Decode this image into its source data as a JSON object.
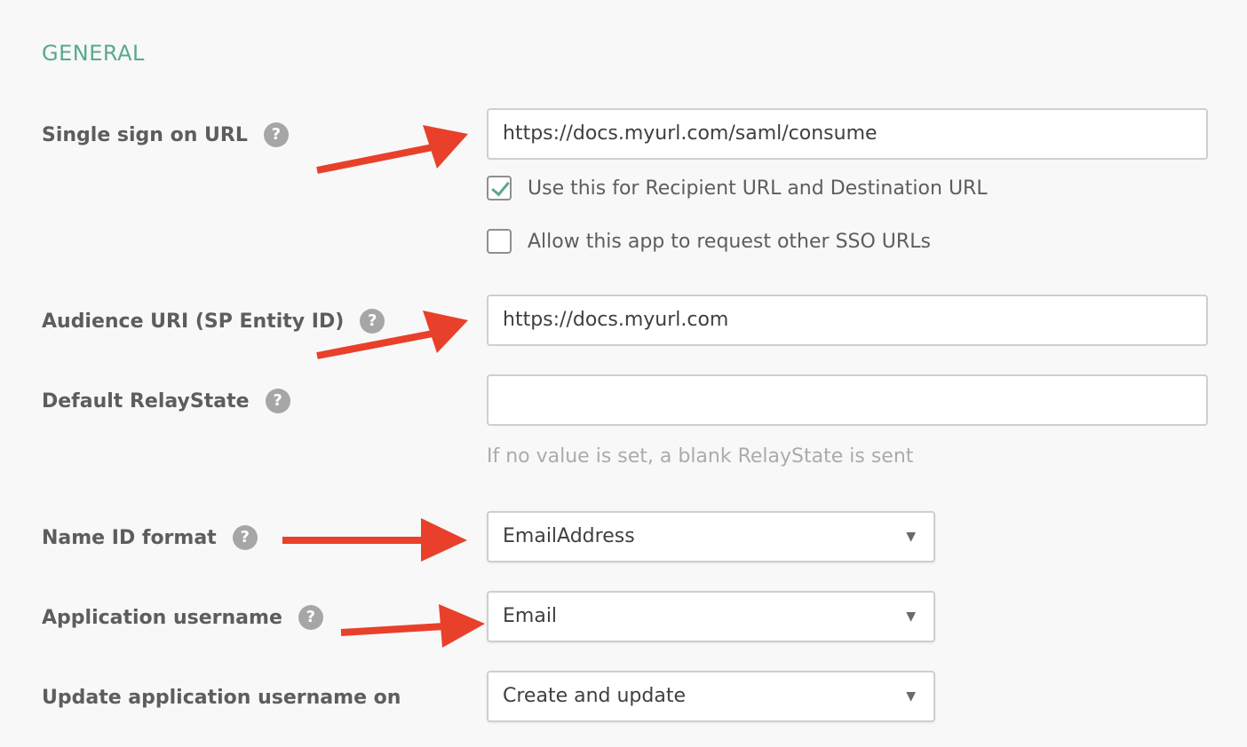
{
  "section": {
    "title": "GENERAL"
  },
  "fields": {
    "sso_url": {
      "label": "Single sign on URL",
      "value": "https://docs.myurl.com/saml/consume"
    },
    "use_recipient": {
      "label": "Use this for Recipient URL and Destination URL",
      "checked": true
    },
    "allow_other_sso": {
      "label": "Allow this app to request other SSO URLs",
      "checked": false
    },
    "audience_uri": {
      "label": "Audience URI (SP Entity ID)",
      "value": "https://docs.myurl.com"
    },
    "relay_state": {
      "label": "Default RelayState",
      "value": "",
      "hint": "If no value is set, a blank RelayState is sent"
    },
    "name_id_format": {
      "label": "Name ID format",
      "selected": "EmailAddress"
    },
    "app_username": {
      "label": "Application username",
      "selected": "Email"
    },
    "update_username_on": {
      "label": "Update application username on",
      "selected": "Create and update"
    }
  },
  "help_glyph": "?",
  "caret_glyph": "▼",
  "colors": {
    "accent": "#5aa88d",
    "annotation_arrow": "#e8402a",
    "help_icon": "#a6a6a6",
    "background": "#f8f8f8"
  },
  "icons": {
    "help": "question-circle-icon",
    "dropdown": "chevron-down-icon",
    "annotation": "red-arrow-icon"
  }
}
